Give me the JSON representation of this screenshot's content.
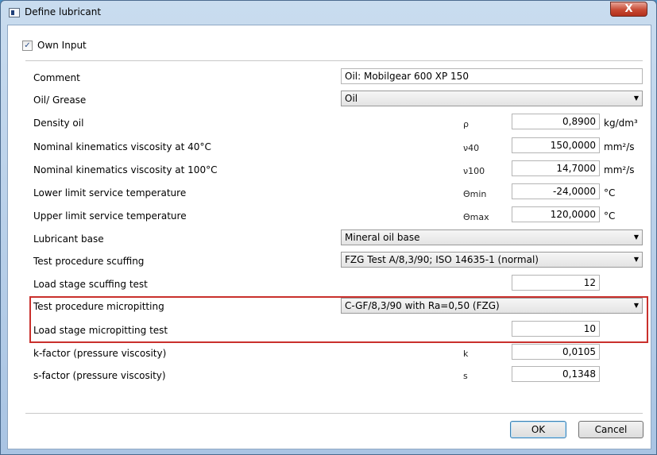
{
  "window": {
    "title": "Define lubricant",
    "close_label": "X"
  },
  "own_input": {
    "label": "Own Input",
    "checked": true,
    "check_mark": "✓"
  },
  "rows": [
    {
      "label": "Comment",
      "symbol": "",
      "value": "Oil: Mobilgear 600 XP 150",
      "unit": ""
    },
    {
      "label": "Oil/ Grease",
      "symbol": "",
      "value": "Oil",
      "unit": ""
    },
    {
      "label": "Density oil",
      "symbol": "ρ",
      "value": "0,8900",
      "unit": "kg/dm³"
    },
    {
      "label": "Nominal kinematics viscosity at 40°C",
      "symbol": "ν40",
      "value": "150,0000",
      "unit": "mm²/s"
    },
    {
      "label": "Nominal kinematics viscosity at 100°C",
      "symbol": "ν100",
      "value": "14,7000",
      "unit": "mm²/s"
    },
    {
      "label": "Lower limit service temperature",
      "symbol": "Θmin",
      "value": "-24,0000",
      "unit": "°C"
    },
    {
      "label": "Upper limit service temperature",
      "symbol": "Θmax",
      "value": "120,0000",
      "unit": "°C"
    },
    {
      "label": "Lubricant base",
      "symbol": "",
      "value": "Mineral oil base",
      "unit": ""
    },
    {
      "label": "Test procedure scuffing",
      "symbol": "",
      "value": "FZG Test A/8,3/90; ISO 14635-1 (normal)",
      "unit": ""
    },
    {
      "label": "Load stage scuffing test",
      "symbol": "",
      "value": "12",
      "unit": ""
    },
    {
      "label": "Test procedure micropitting",
      "symbol": "",
      "value": "C-GF/8,3/90 with Ra=0,50 (FZG)",
      "unit": ""
    },
    {
      "label": "Load stage micropitting test",
      "symbol": "",
      "value": "10",
      "unit": ""
    },
    {
      "label": "k-factor (pressure viscosity)",
      "symbol": "k",
      "value": "0,0105",
      "unit": ""
    },
    {
      "label": "s-factor (pressure viscosity)",
      "symbol": "s",
      "value": "0,1348",
      "unit": ""
    }
  ],
  "dropdown_arrow": "▼",
  "buttons": {
    "ok": "OK",
    "cancel": "Cancel"
  },
  "colors": {
    "highlight": "#c9302c",
    "close_button": "#c74a34"
  }
}
